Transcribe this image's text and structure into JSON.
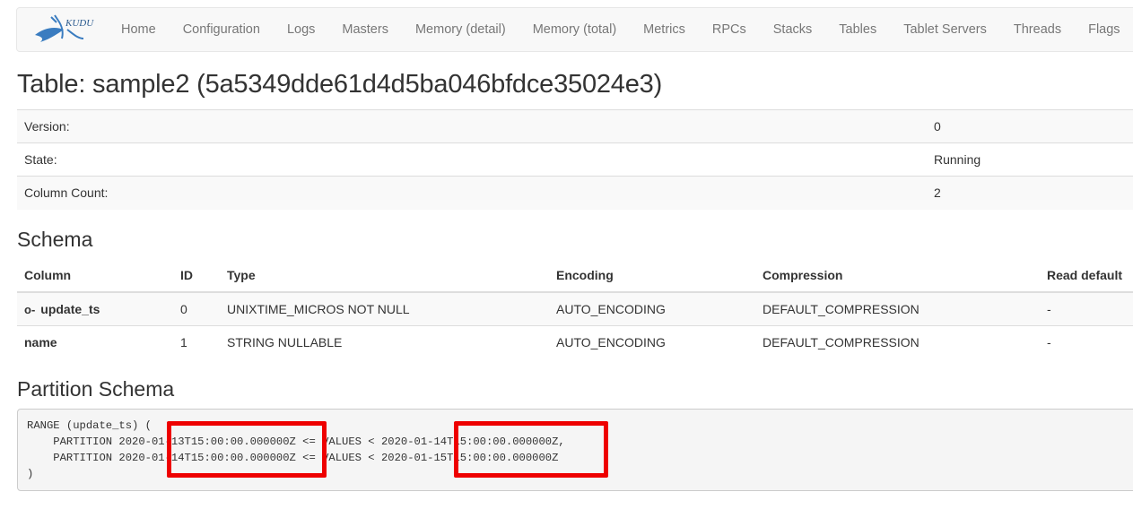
{
  "navbar": {
    "logo_text": "KUDU",
    "items": [
      "Home",
      "Configuration",
      "Logs",
      "Masters",
      "Memory (detail)",
      "Memory (total)",
      "Metrics",
      "RPCs",
      "Stacks",
      "Tables",
      "Tablet Servers",
      "Threads",
      "Flags"
    ]
  },
  "page_title": "Table: sample2 (5a5349dde61d4d5ba046bfdce35024e3)",
  "info": [
    {
      "label": "Version:",
      "value": "0"
    },
    {
      "label": "State:",
      "value": "Running"
    },
    {
      "label": "Column Count:",
      "value": "2"
    }
  ],
  "schema": {
    "heading": "Schema",
    "headers": [
      "Column",
      "ID",
      "Type",
      "Encoding",
      "Compression",
      "Read default"
    ],
    "key_icon": "o-",
    "rows": [
      {
        "column": "update_ts",
        "id": "0",
        "type": "UNIXTIME_MICROS NOT NULL",
        "encoding": "AUTO_ENCODING",
        "compression": "DEFAULT_COMPRESSION",
        "read_default": "-"
      },
      {
        "column": "name",
        "id": "1",
        "type": "STRING NULLABLE",
        "encoding": "AUTO_ENCODING",
        "compression": "DEFAULT_COMPRESSION",
        "read_default": "-"
      }
    ]
  },
  "partition": {
    "heading": "Partition Schema",
    "text": "RANGE (update_ts) (\n    PARTITION 2020-01-13T15:00:00.000000Z <= VALUES < 2020-01-14T15:00:00.000000Z,\n    PARTITION 2020-01-14T15:00:00.000000Z <= VALUES < 2020-01-15T15:00:00.000000Z\n)"
  },
  "colors": {
    "highlight": "#ee0000",
    "navbar_bg": "#f8f8f8",
    "stripe": "#f9f9f9"
  }
}
